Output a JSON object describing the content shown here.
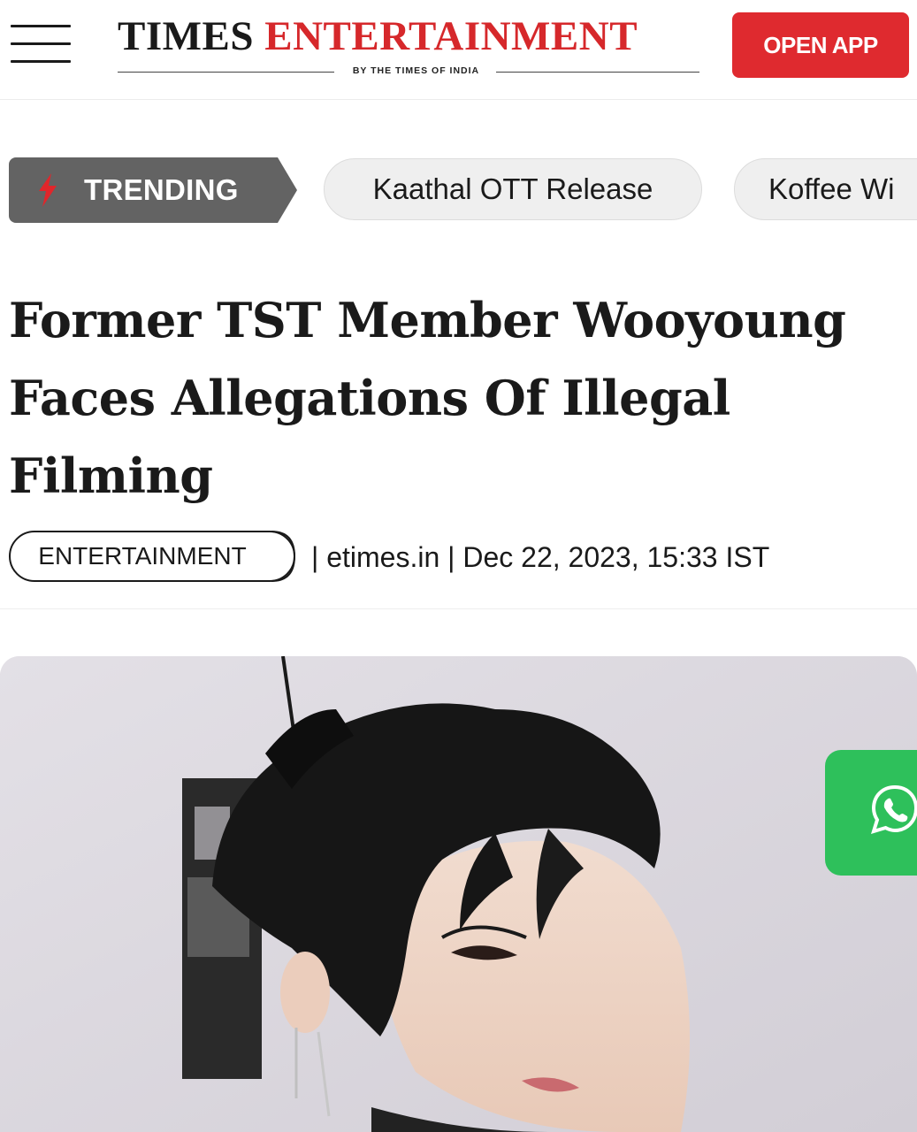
{
  "header": {
    "menu_icon": "hamburger-menu-icon",
    "logo": {
      "part1": "TIMES",
      "part2": "ENTERTAINMENT",
      "byline": "BY THE TIMES OF INDIA"
    },
    "open_app_label": "OPEN APP",
    "brand_red": "#d6282b"
  },
  "trending": {
    "label": "TRENDING",
    "icon": "lightning-bolt-icon",
    "chips": [
      "Kaathal OTT Release",
      "Koffee Wi"
    ]
  },
  "article": {
    "headline": "Former TST Member Wooyoung Faces Allegations Of Illegal Filming",
    "category": "ENTERTAINMENT",
    "source_line": "| etimes.in | Dec 22, 2023, 15:33 IST"
  },
  "hero_image": {
    "description_icon": "article-photo"
  },
  "share": {
    "icon": "whatsapp-icon",
    "color": "#2ec05b"
  }
}
